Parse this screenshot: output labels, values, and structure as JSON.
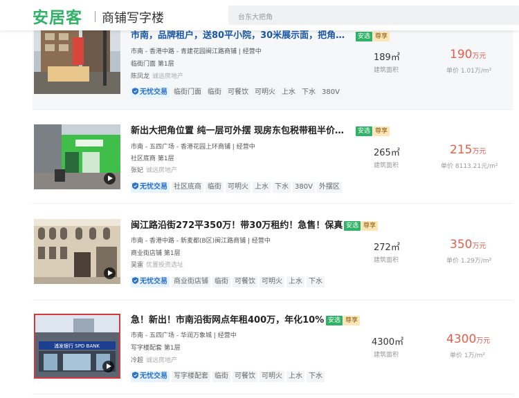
{
  "header": {
    "logo": "安居客",
    "subtitle": "商铺写字楼",
    "search_placeholder": "台东大把角"
  },
  "listings": [
    {
      "title": "市南，品牌租户，送80平小院，30米展示面，把角…",
      "badges": [
        "安选",
        "尊享"
      ],
      "location": "市南 - 香港中路 - 青建花园闽江路商铺 | 经营中",
      "floor": "临街门面 第1层",
      "agent": "陈凤龙",
      "agency": "诚远房地产",
      "labels": [
        "无忧交易",
        "临街门面",
        "临街",
        "可餐饮",
        "可明火",
        "上水",
        "下水",
        "380V"
      ],
      "area": "189㎡",
      "area_label": "建筑面积",
      "price": "190",
      "price_unit": "万元",
      "unit_price": "单价 1.01万/m²"
    },
    {
      "title": "新出大把角位置 纯一层可外摆 现房东包税带租半价…",
      "badges": [
        "安选",
        "尊享"
      ],
      "location": "市南 - 五四广场 - 香港花园上环商铺 | 经营中",
      "floor": "社区底商 第1层",
      "agent": "张妃",
      "agency": "诚远房地产",
      "labels": [
        "无忧交易",
        "社区底商",
        "临街",
        "可明火",
        "上水",
        "下水",
        "380V",
        "外摆区"
      ],
      "area": "265㎡",
      "area_label": "建筑面积",
      "price": "215",
      "price_unit": "万元",
      "unit_price": "单价 8113.21元/m²"
    },
    {
      "title": "闽江路沿街272平350万！带30万租约！急售！保真",
      "badges": [
        "安选",
        "尊享"
      ],
      "location": "市南 - 香港中路 - 新麦都(B区)闽江路商铺 | 经营中",
      "floor": "商业街店铺 第1层",
      "agent": "吴雷",
      "agency": "优置投资选址",
      "labels": [
        "无忧交易",
        "商业街店铺",
        "临街",
        "可餐饮",
        "可明火",
        "上水",
        "下水"
      ],
      "area": "272㎡",
      "area_label": "建筑面积",
      "price": "350",
      "price_unit": "万元",
      "unit_price": "单价 1.29万/m²"
    },
    {
      "title": "急！新出！市南沿街网点年租400万，年化10%",
      "badges": [
        "安选",
        "尊享"
      ],
      "location": "市南 - 五四广场 - 华润万象城 | 经营中",
      "floor": "写字楼配套 第1层",
      "agent": "冷超",
      "agency": "诚远房地产",
      "labels": [
        "无忧交易",
        "写字楼配套",
        "临街",
        "可餐饮",
        "可明火",
        "上水",
        "下水"
      ],
      "area": "4300㎡",
      "area_label": "建筑面积",
      "price": "4300",
      "price_unit": "万元",
      "unit_price": "单价 1万/m²",
      "thumb_sign": "浦发银行 SPD BANK"
    }
  ],
  "colors": {
    "brand_green": "#2fb265",
    "price_red": "#e85d4a",
    "title_blue": "#1a57a8"
  }
}
